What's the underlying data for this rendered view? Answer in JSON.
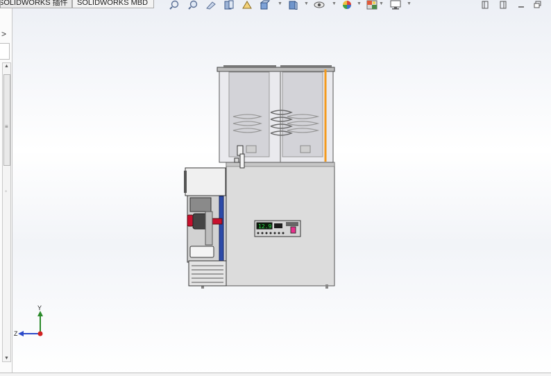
{
  "tabs": [
    "SOLIDWORKS 插件",
    "SOLIDWORKS MBD"
  ],
  "toolbar": {
    "icons": [
      "zoom-to-fit-icon",
      "zoom-to-area-icon",
      "previous-view-icon",
      "section-view-icon",
      "dynamic-annotation-view-icon",
      "view-orientation-icon",
      "display-style-icon",
      "hide-show-items-icon",
      "edit-appearance-icon",
      "apply-scene-icon",
      "view-settings-icon"
    ]
  },
  "window_controls": [
    "restore-view-icon",
    "next-view-icon",
    "minimize-icon",
    "maximize-icon"
  ],
  "model": {
    "controller_display": "12.9"
  },
  "triad": {
    "y_label": "Y",
    "z_label": "Z"
  },
  "colors": {
    "accent_orange": "#f39a1e",
    "knob_red": "#c8102e",
    "display_green": "#2ce04a",
    "button_pink": "#e8308c"
  }
}
